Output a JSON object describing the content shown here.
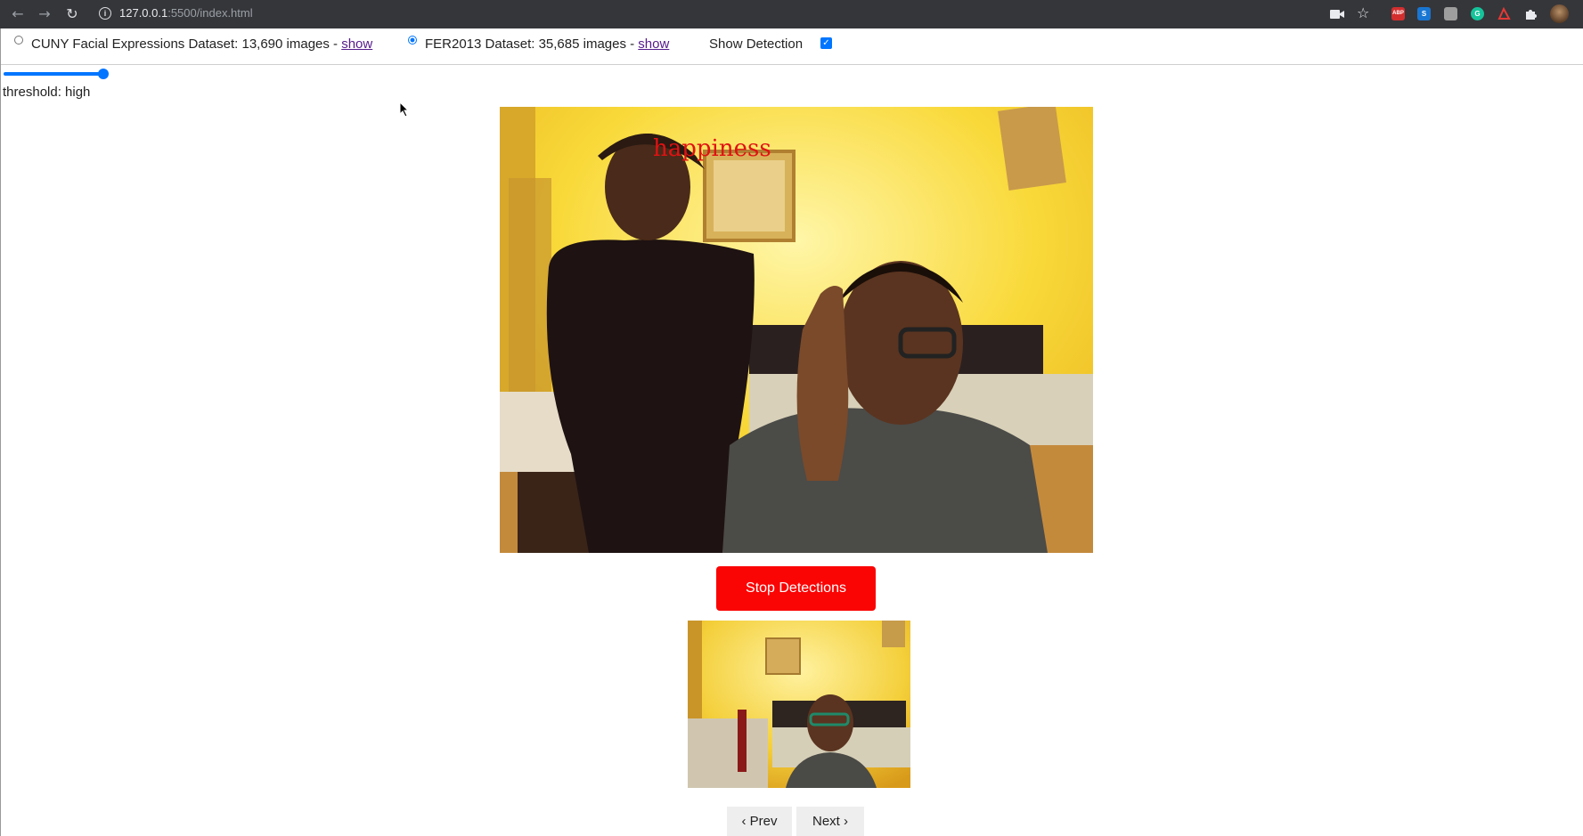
{
  "browser": {
    "url_host": "127.0.0.1",
    "url_rest": ":5500/index.html",
    "icons": [
      "back-arrow-icon",
      "forward-arrow-icon",
      "reload-icon",
      "site-info-icon",
      "camera-icon",
      "star-icon",
      "adblock-extension-icon",
      "s-extension-icon",
      "gray-extension-icon",
      "grammarly-extension-icon",
      "pdf-extension-icon",
      "puzzle-extension-icon",
      "profile-avatar"
    ],
    "ext_labels": {
      "abp": "ABP",
      "s": "S",
      "g": "G"
    }
  },
  "controls": {
    "dataset1_label": "CUNY Facial Expressions Dataset: 13,690 images - ",
    "dataset1_link": "show",
    "dataset1_selected": false,
    "dataset2_label": "FER2013 Dataset: 35,685 images - ",
    "dataset2_link": "show",
    "dataset2_selected": true,
    "show_detection_label": "Show Detection",
    "show_detection_checked": true
  },
  "threshold": {
    "label": "threshold: high",
    "slider_fraction": 1.0
  },
  "detection": {
    "emotion_label": "happiness",
    "emotion_color": "#e01212"
  },
  "buttons": {
    "stop": "Stop Detections",
    "stop_color": "#fa0404",
    "prev": "‹ Prev",
    "next": "Next ›"
  },
  "accent": "#0075ff"
}
